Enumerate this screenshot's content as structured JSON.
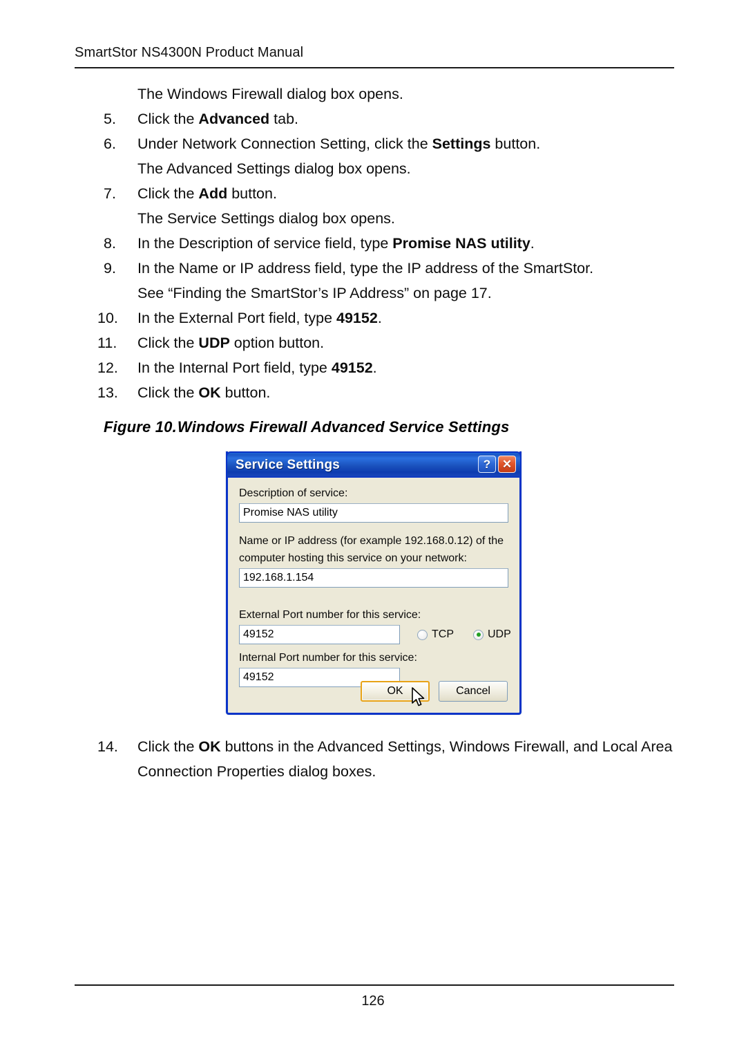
{
  "header": {
    "title": "SmartStor NS4300N Product Manual"
  },
  "content": {
    "intro_line": "The Windows Firewall dialog box opens.",
    "steps": [
      {
        "num": "5.",
        "html": "Click the <b>Advanced</b> tab."
      },
      {
        "num": "6.",
        "html": "Under Network Connection Setting, click the <b>Settings</b> button."
      },
      {
        "num": "",
        "html": "The Advanced Settings dialog box opens."
      },
      {
        "num": "7.",
        "html": "Click the <b>Add</b> button."
      },
      {
        "num": "",
        "html": "The Service Settings dialog box opens."
      },
      {
        "num": "8.",
        "html": "In the Description of service field, type <b>Promise NAS utility</b>."
      },
      {
        "num": "9.",
        "html": "In the Name or IP address field, type the IP address of the SmartStor."
      },
      {
        "num": "",
        "html": "See “Finding the SmartStor’s IP Address” on page 17."
      },
      {
        "num": "10.",
        "html": "In the External Port field, type <b>49152</b>."
      },
      {
        "num": "11.",
        "html": "Click the <b>UDP</b> option button."
      },
      {
        "num": "12.",
        "html": "In the Internal Port field, type <b>49152</b>."
      },
      {
        "num": "13.",
        "html": "Click the <b>OK</b> button."
      }
    ],
    "final_step": {
      "num": "14.",
      "html": "Click the <b>OK</b> buttons in the Advanced Settings, Windows Firewall, and Local Area Connection Properties dialog boxes."
    }
  },
  "figure": {
    "label": "Figure 10.",
    "caption": "Windows Firewall Advanced Service Settings"
  },
  "dialog": {
    "title": "Service Settings",
    "help_button": "?",
    "close_button": "✕",
    "description_label": "Description of service:",
    "description_value": "Promise NAS utility",
    "host_label_line1": "Name or IP address (for example 192.168.0.12) of the",
    "host_label_line2": "computer hosting this service on your network:",
    "host_value": "192.168.1.154",
    "external_port_label": "External Port number for this service:",
    "external_port_value": "49152",
    "internal_port_label": "Internal Port number for this service:",
    "internal_port_value": "49152",
    "protocol_tcp": "TCP",
    "protocol_udp": "UDP",
    "protocol_selected": "UDP",
    "ok_label": "OK",
    "cancel_label": "Cancel",
    "colors": {
      "titlebar_blue": "#0a34c8",
      "dialog_face": "#ece9d8",
      "default_button_focus": "#e8a317",
      "radio_dot_green": "#23a025",
      "close_button_red": "#e2562b"
    }
  },
  "footer": {
    "page_number": "126"
  }
}
